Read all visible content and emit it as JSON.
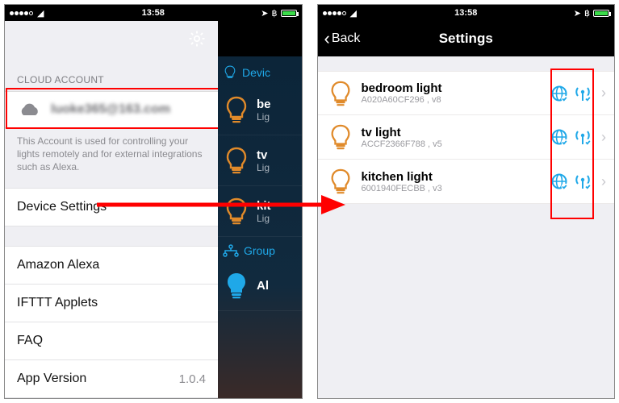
{
  "statusbar": {
    "time": "13:58",
    "carrier_dots": 4
  },
  "panel1": {
    "section_label": "CLOUD ACCOUNT",
    "account_email": "luoke365@163.com",
    "account_desc": "This Account is used for controlling your lights remotely and for external integrations such as Alexa.",
    "menu": {
      "device_settings": "Device Settings",
      "alexa": "Amazon Alexa",
      "ifttt": "IFTTT Applets",
      "faq": "FAQ",
      "app_version_label": "App Version",
      "app_version_value": "1.0.4"
    },
    "strip": {
      "devices_head": "Devic",
      "groups_head": "Group",
      "rows": [
        {
          "name": "be",
          "sub": "Lig"
        },
        {
          "name": "tv",
          "sub": "Lig"
        },
        {
          "name": "kit",
          "sub": "Lig"
        }
      ],
      "all": "Al"
    }
  },
  "panel2": {
    "back": "Back",
    "title": "Settings",
    "devices": [
      {
        "name": "bedroom light",
        "id": "A020A60CF296 , v8"
      },
      {
        "name": "tv light",
        "id": "ACCF2366F788 , v5"
      },
      {
        "name": "kitchen light",
        "id": "6001940FECBB , v3"
      }
    ]
  }
}
